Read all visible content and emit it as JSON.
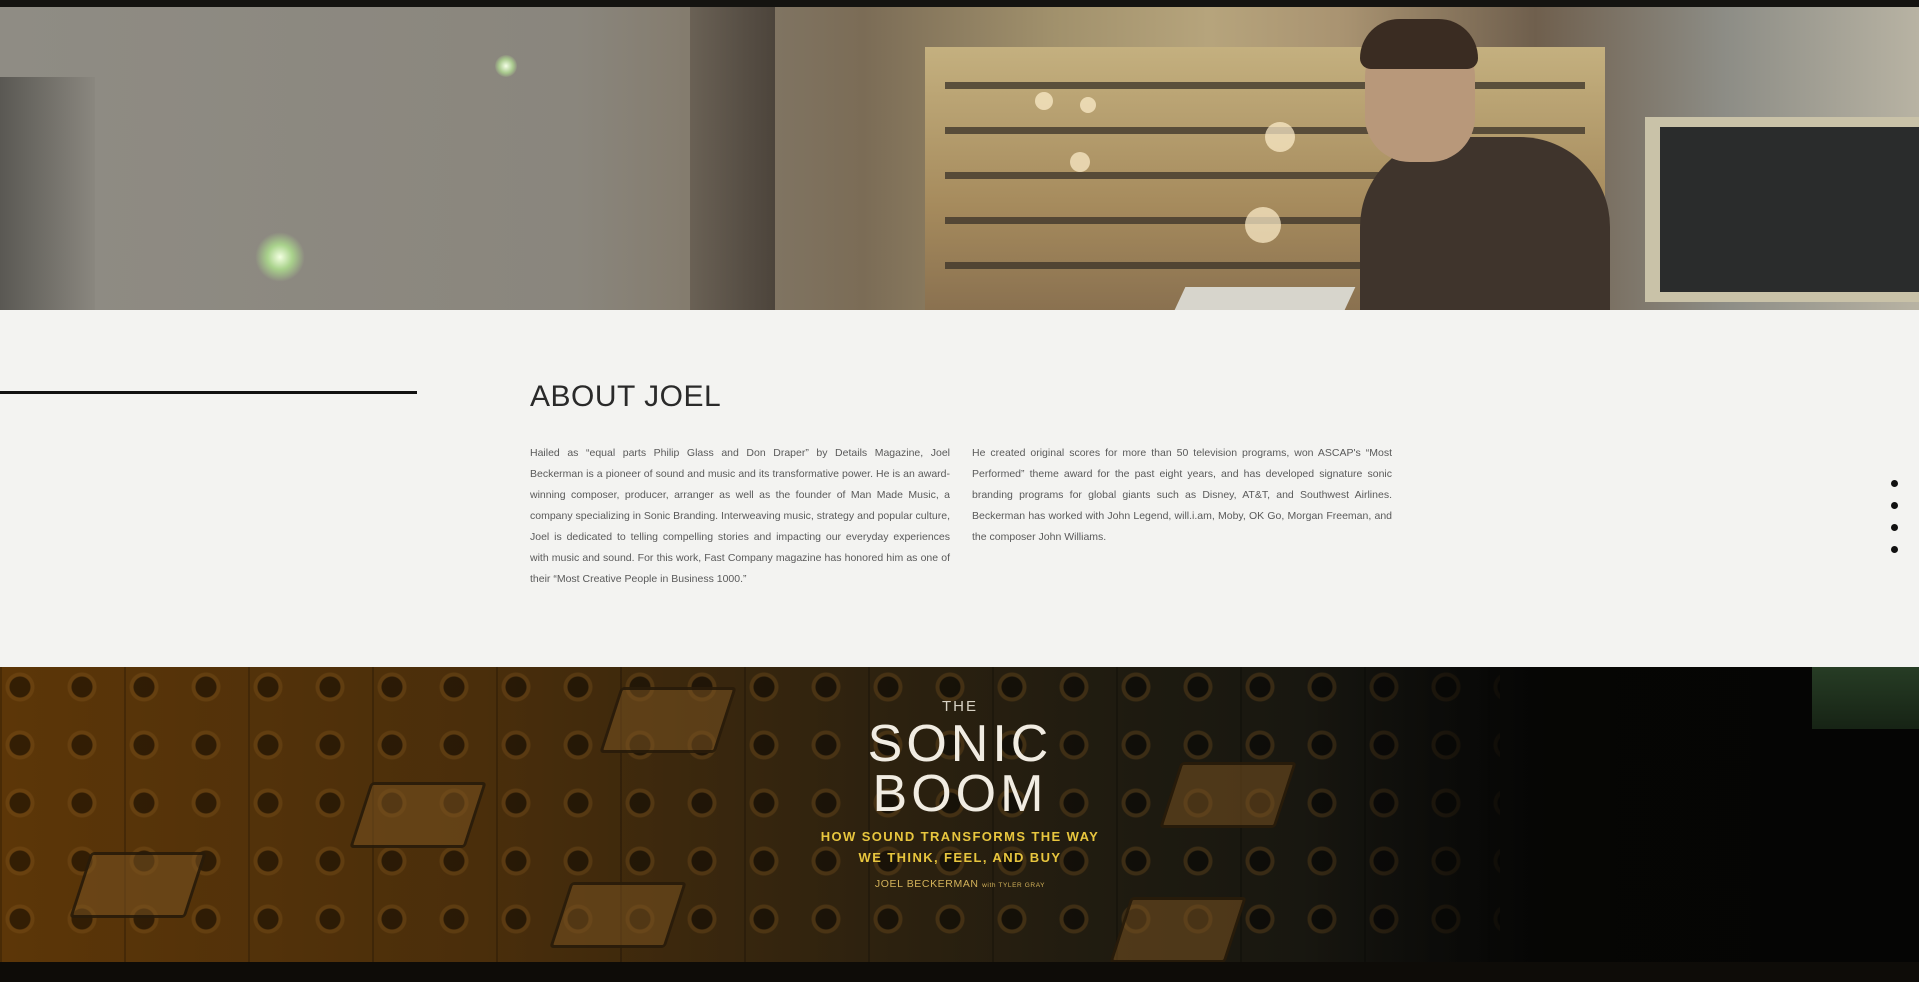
{
  "about": {
    "title": "ABOUT JOEL",
    "paragraph_1": "Hailed as “equal parts Philip Glass and Don Draper” by Details Magazine, Joel Beckerman is a pioneer of sound and music and its transformative power. He is an award-winning composer, producer, arranger as well as the founder of Man Made Music, a company specializing in Sonic Branding. Interweaving music, strategy and popular culture, Joel is dedicated to telling compelling stories and impacting our everyday experiences with music and sound. For this work, Fast Company magazine has honored him as one of their “Most Creative People in Business 1000.”",
    "paragraph_2": "He created original scores for more than 50 television programs, won ASCAP's “Most Performed” theme award for the past eight years, and has developed signature sonic branding programs for global giants such as Disney, AT&T, and Southwest Airlines. Beckerman has worked with John Legend, will.i.am, Moby, OK Go, Morgan Freeman, and the composer John Williams."
  },
  "section_nav": {
    "count": 4
  },
  "book": {
    "the": "THE",
    "title_line_1": "SONIC",
    "title_line_2": "BOOM",
    "subtitle_line_1": "HOW SOUND TRANSFORMS THE WAY",
    "subtitle_line_2": "WE THINK, FEEL, AND BUY",
    "author": "JOEL BECKERMAN",
    "with": "with TYLER GRAY"
  },
  "colors": {
    "about_background": "#f3f3f1",
    "book_subtitle": "#e8c63e",
    "rule": "#111111"
  }
}
